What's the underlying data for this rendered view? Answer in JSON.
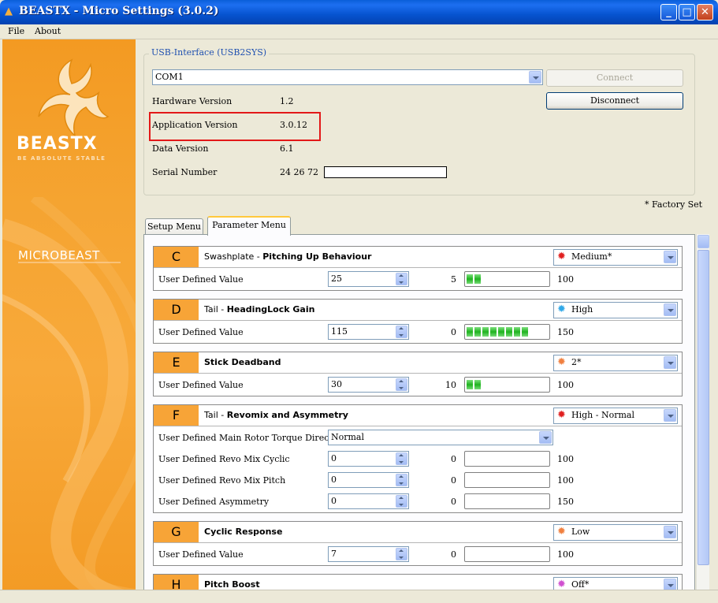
{
  "window": {
    "title": "BEASTX - Micro Settings (3.0.2)"
  },
  "menu": [
    "File",
    "About"
  ],
  "banner": {
    "brand": "BEASTX",
    "tagline": "BE ABSOLUTE STABLE",
    "product": "MICROBEAST"
  },
  "usb": {
    "legend": "USB-Interface (USB2SYS)",
    "port": "COM1",
    "connect_label": "Connect",
    "disconnect_label": "Disconnect",
    "fields": [
      {
        "label": "Hardware Version",
        "value": "1.2"
      },
      {
        "label": "Application Version",
        "value": "3.0.12"
      },
      {
        "label": "Data Version",
        "value": "6.1"
      },
      {
        "label": "Serial Number",
        "value": "24 26 72"
      }
    ]
  },
  "factory_note": "* Factory Set",
  "tabs": [
    {
      "label": "Setup Menu"
    },
    {
      "label": "Parameter Menu"
    }
  ],
  "params": [
    {
      "letter": "C",
      "prefix": "Swashplate - ",
      "title": "Pitching Up Behaviour",
      "option": "Medium*",
      "sun": "#e02020",
      "rows": [
        {
          "label": "User Defined Value",
          "value": "25",
          "min": "5",
          "max": "100",
          "segments": 2
        }
      ]
    },
    {
      "letter": "D",
      "prefix": "Tail - ",
      "title": "HeadingLock Gain",
      "option": "High",
      "sun": "#30a8e8",
      "rows": [
        {
          "label": "User Defined Value",
          "value": "115",
          "min": "0",
          "max": "150",
          "segments": 8
        }
      ]
    },
    {
      "letter": "E",
      "prefix": "",
      "title": "Stick Deadband",
      "option": "2*",
      "sun": "#f08040",
      "rows": [
        {
          "label": "User Defined Value",
          "value": "30",
          "min": "10",
          "max": "100",
          "segments": 2
        }
      ]
    },
    {
      "letter": "F",
      "prefix": "Tail - ",
      "title": "Revomix and Asymmetry",
      "option": "High - Normal",
      "sun": "#e02020",
      "combo_row": {
        "label": "User Defined Main Rotor Torque Direction",
        "value": "Normal"
      },
      "rows": [
        {
          "label": "User Defined Revo Mix Cyclic",
          "value": "0",
          "min": "0",
          "max": "100",
          "segments": 0
        },
        {
          "label": "User Defined Revo Mix Pitch",
          "value": "0",
          "min": "0",
          "max": "100",
          "segments": 0
        },
        {
          "label": "User Defined Asymmetry",
          "value": "0",
          "min": "0",
          "max": "150",
          "segments": 0
        }
      ]
    },
    {
      "letter": "G",
      "prefix": "",
      "title": "Cyclic Response",
      "option": "Low",
      "sun": "#f08040",
      "rows": [
        {
          "label": "User Defined Value",
          "value": "7",
          "min": "0",
          "max": "100",
          "segments": 0
        }
      ]
    },
    {
      "letter": "H",
      "prefix": "",
      "title": "Pitch Boost",
      "option": "Off*",
      "sun": "#d050d0",
      "rows": []
    }
  ]
}
